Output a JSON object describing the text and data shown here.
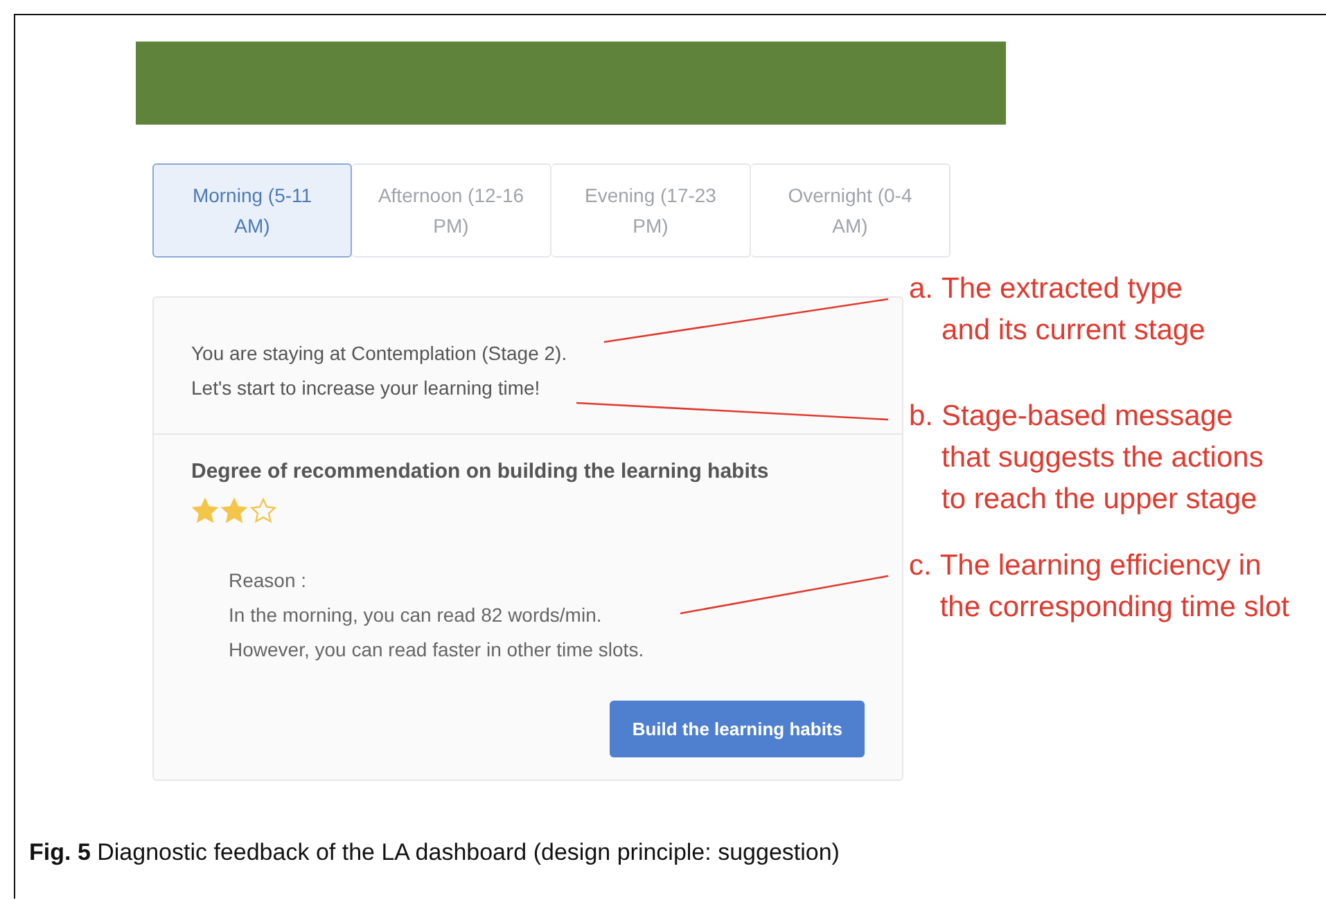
{
  "tabs": [
    {
      "label": "Morning (5-11 AM)",
      "selected": true
    },
    {
      "label": "Afternoon (12-16 PM)",
      "selected": false
    },
    {
      "label": "Evening (17-23 PM)",
      "selected": false
    },
    {
      "label": "Overnight (0-4 AM)",
      "selected": false
    }
  ],
  "stage_message": [
    "You are staying at Contemplation (Stage 2).",
    "Let's start to increase your learning time!"
  ],
  "recommendation": {
    "heading": "Degree of recommendation on building the learning habits",
    "stars": 2,
    "reason_label": "Reason :",
    "reason_lines": [
      "In the morning, you can read 82 words/min.",
      "However, you can read faster in other time slots."
    ],
    "button": "Build the learning habits"
  },
  "annotations": [
    {
      "label": "a.",
      "lines": [
        "The extracted type",
        "and its current stage"
      ]
    },
    {
      "label": "b.",
      "lines": [
        "Stage-based message",
        "that suggests the actions",
        "to reach the upper stage"
      ]
    },
    {
      "label": "c.",
      "lines": [
        "The learning efficiency in",
        "the corresponding time slot"
      ]
    }
  ],
  "caption": "**Fig. 5** Diagnostic feedback of the LA dashboard (design principle: suggestion)"
}
